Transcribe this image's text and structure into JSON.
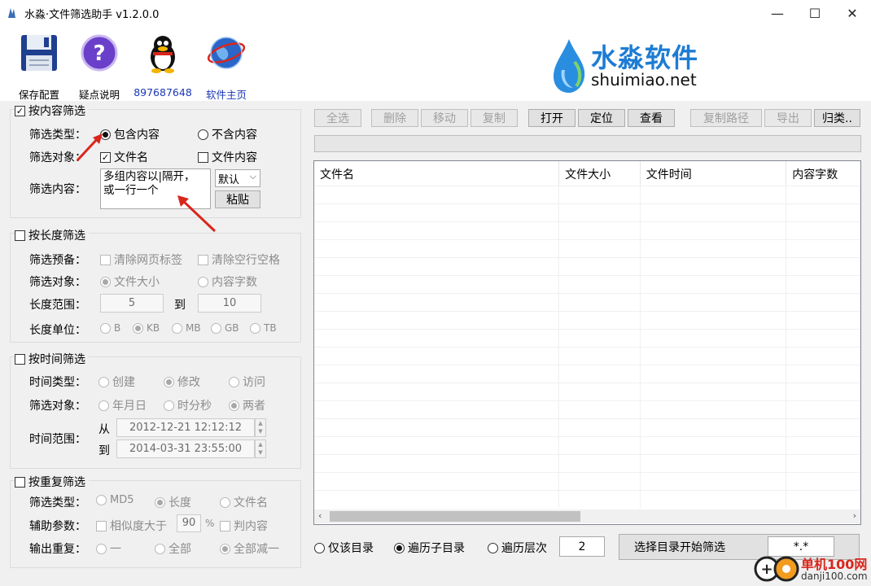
{
  "window": {
    "title": "水淼·文件筛选助手 v1.2.0.0",
    "minimize": "—",
    "maximize": "☐",
    "close": "✕"
  },
  "toolbar": {
    "save_label": "保存配置",
    "help_label": "疑点说明",
    "qq_label": "897687648",
    "home_label": "软件主页"
  },
  "logo": {
    "name": "水淼软件",
    "url": "shuimiao.net"
  },
  "content_filter": {
    "title": "按内容筛选",
    "checked": true,
    "type_label": "筛选类型：",
    "type_options": [
      "包含内容",
      "不含内容"
    ],
    "target_label": "筛选对象：",
    "target_options": [
      "文件名",
      "文件内容"
    ],
    "content_label": "筛选内容：",
    "content_value": "多组内容以|隔开，\n或一行一个",
    "mode_value": "默认",
    "paste_label": "粘贴"
  },
  "length_filter": {
    "title": "按长度筛选",
    "prep_label": "筛选预备：",
    "prep_options": [
      "清除网页标签",
      "清除空行空格"
    ],
    "target_label": "筛选对象：",
    "target_options": [
      "文件大小",
      "内容字数"
    ],
    "range_label": "长度范围：",
    "range_from": "5",
    "range_to_label": "到",
    "range_to": "10",
    "unit_label": "长度单位：",
    "unit_options": [
      "B",
      "KB",
      "MB",
      "GB",
      "TB"
    ]
  },
  "time_filter": {
    "title": "按时间筛选",
    "type_label": "时间类型：",
    "type_options": [
      "创建",
      "修改",
      "访问"
    ],
    "target_label": "筛选对象：",
    "target_options": [
      "年月日",
      "时分秒",
      "两者"
    ],
    "range_label": "时间范围：",
    "from_label": "从",
    "from_value": "2012-12-21 12:12:12",
    "to_label": "到",
    "to_value": "2014-03-31 23:55:00"
  },
  "dup_filter": {
    "title": "按重复筛选",
    "type_label": "筛选类型：",
    "type_options": [
      "MD5",
      "长度",
      "文件名"
    ],
    "aux_label": "辅助参数：",
    "similar_label": "相似度大于",
    "similar_value": "90",
    "percent": "%",
    "judge_label": "判内容",
    "output_label": "输出重复：",
    "output_options": [
      "一",
      "全部",
      "全部减一"
    ]
  },
  "actions": {
    "select_all": "全选",
    "delete": "删除",
    "move": "移动",
    "copy": "复制",
    "open": "打开",
    "locate": "定位",
    "view": "查看",
    "copy_path": "复制路径",
    "export": "导出",
    "classify": "归类.."
  },
  "table": {
    "columns": [
      "文件名",
      "文件大小",
      "文件时间",
      "内容字数"
    ]
  },
  "bottom": {
    "scope_options": [
      "仅该目录",
      "遍历子目录",
      "遍历层次"
    ],
    "depth_value": "2",
    "start_label": "选择目录开始筛选",
    "pattern_value": "*.*"
  },
  "watermark": {
    "line1": "单机100网",
    "line2": "danji100.com"
  },
  "colors": {
    "accent_red": "#d9261c",
    "logo_blue": "#1d7cd4",
    "link_blue": "#1a37b5"
  }
}
